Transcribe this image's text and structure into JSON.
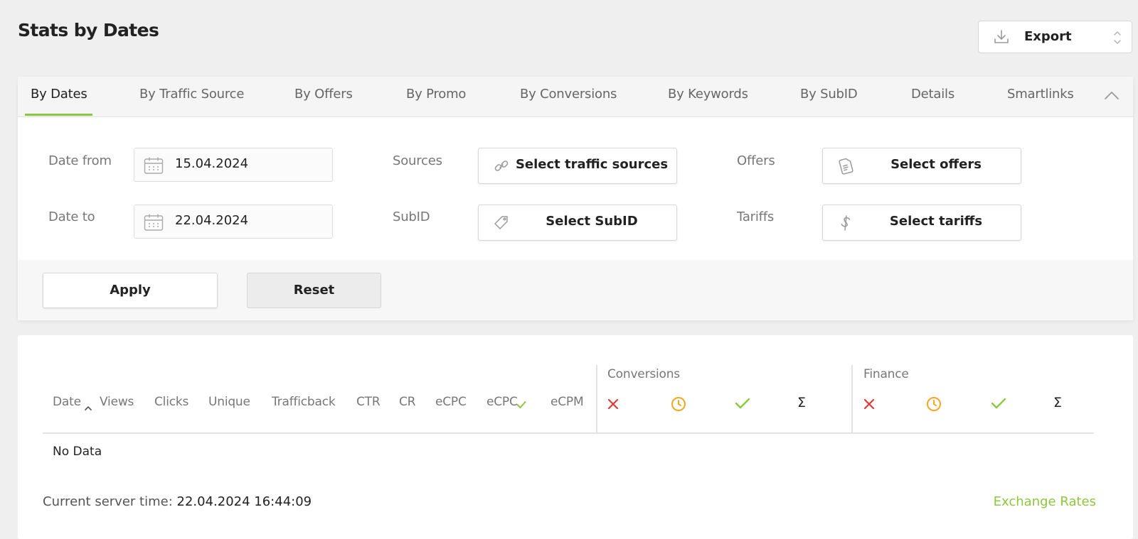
{
  "page": {
    "title": "Stats by Dates"
  },
  "export": {
    "label": "Export"
  },
  "tabs": [
    {
      "label": "By Dates",
      "active": true
    },
    {
      "label": "By Traffic Source"
    },
    {
      "label": "By Offers"
    },
    {
      "label": "By Promo"
    },
    {
      "label": "By Conversions"
    },
    {
      "label": "By Keywords"
    },
    {
      "label": "By SubID"
    },
    {
      "label": "Details"
    },
    {
      "label": "Smartlinks"
    }
  ],
  "filters": {
    "date_from": {
      "label": "Date from",
      "value": "15.04.2024"
    },
    "date_to": {
      "label": "Date to",
      "value": "22.04.2024"
    },
    "sources": {
      "label": "Sources",
      "button": "Select traffic sources"
    },
    "subid": {
      "label": "SubID",
      "button": "Select SubID"
    },
    "offers": {
      "label": "Offers",
      "button": "Select offers"
    },
    "tariffs": {
      "label": "Tariffs",
      "button": "Select tariffs"
    }
  },
  "actions": {
    "apply": "Apply",
    "reset": "Reset"
  },
  "table": {
    "columns": [
      "Date",
      "Views",
      "Clicks",
      "Unique",
      "Trafficback",
      "CTR",
      "CR",
      "eCPC",
      "eCPC",
      "eCPM"
    ],
    "groups": {
      "conversions": "Conversions",
      "finance": "Finance"
    },
    "sum_symbol": "Σ",
    "empty": "No Data"
  },
  "footer": {
    "server_time_label": "Current server time:",
    "server_time_value": "22.04.2024 16:44:09",
    "exchange_rates": "Exchange Rates"
  },
  "colors": {
    "accent": "#8dc63f",
    "rejected": "#e53935",
    "pending": "#f5a623"
  }
}
